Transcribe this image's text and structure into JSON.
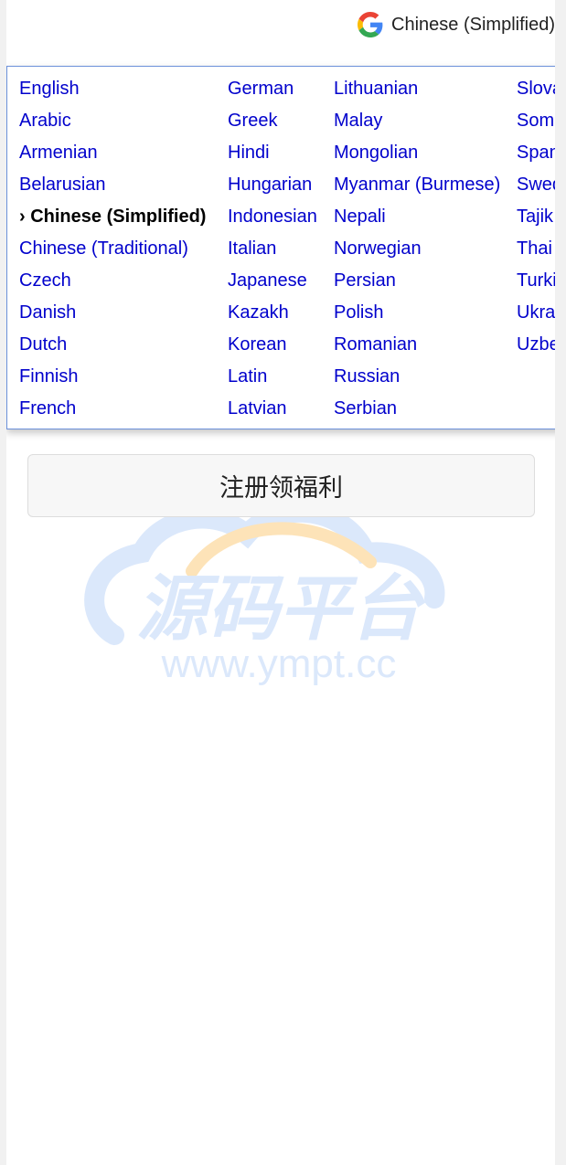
{
  "translate_widget": {
    "icon": "google-g-icon",
    "current_language": "Chinese (Simplified)"
  },
  "language_menu": {
    "columns": [
      [
        "English",
        "Arabic",
        "Armenian",
        "Belarusian",
        "› Chinese (Simplified)",
        "Chinese (Traditional)",
        "Czech",
        "Danish",
        "Dutch",
        "Finnish",
        "French"
      ],
      [
        "German",
        "Greek",
        "Hindi",
        "Hungarian",
        "Indonesian",
        "Italian",
        "Japanese",
        "Kazakh",
        "Korean",
        "Latin",
        "Latvian"
      ],
      [
        "Lithuanian",
        "Malay",
        "Mongolian",
        "Myanmar (Burmese)",
        "Nepali",
        "Norwegian",
        "Persian",
        "Polish",
        "Romanian",
        "Russian",
        "Serbian"
      ],
      [
        "Slova",
        "Soma",
        "Span",
        "Swed",
        "Tajik",
        "Thai",
        "Turki",
        "Ukra",
        "Uzbe"
      ]
    ]
  },
  "signup_button": {
    "label": "注册领福利"
  },
  "watermark": {
    "text_cn": "源码平台",
    "text_url": "www.ympt.cc"
  },
  "colors": {
    "link": "#0000cc",
    "menu_border": "#6b90da",
    "watermark": "#dbe8fb",
    "watermark_accent": "#fde3b8"
  }
}
